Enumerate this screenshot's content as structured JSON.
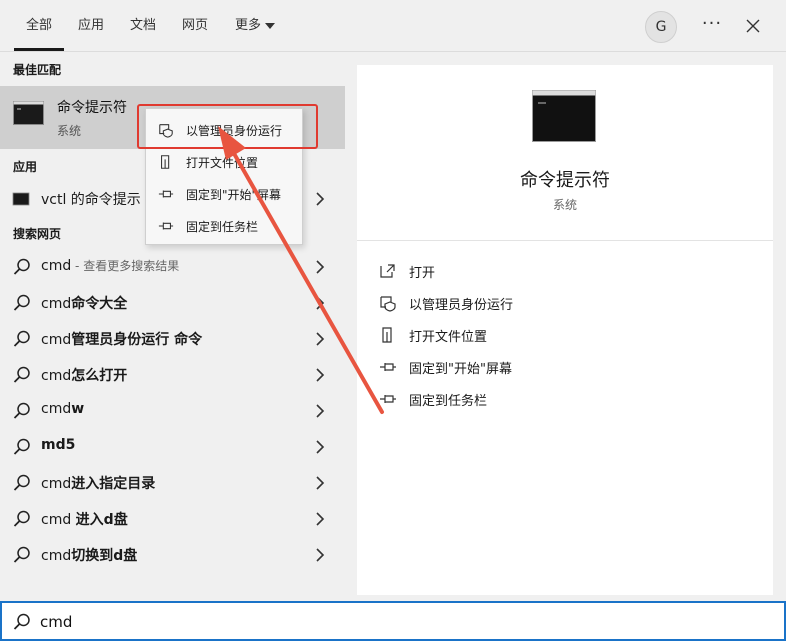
{
  "tabs": [
    {
      "label": "全部",
      "active": true
    },
    {
      "label": "应用"
    },
    {
      "label": "文档"
    },
    {
      "label": "网页"
    },
    {
      "label": "更多"
    }
  ],
  "account": {
    "initial": "G"
  },
  "sections": {
    "best_match": "最佳匹配",
    "apps": "应用",
    "web": "搜索网页"
  },
  "best_match": {
    "title": "命令提示符",
    "subtitle": "系统",
    "icon": "terminal-icon"
  },
  "apps": [
    {
      "label": "vctl 的命令提示"
    }
  ],
  "web_results": [
    {
      "prefix": "cmd",
      "bold": "",
      "dim": " - 查看更多搜索结果"
    },
    {
      "prefix": "cmd",
      "bold": "命令大全",
      "dim": ""
    },
    {
      "prefix": "cmd",
      "bold": "管理员身份运行 命令",
      "dim": ""
    },
    {
      "prefix": "cmd",
      "bold": "怎么打开",
      "dim": ""
    },
    {
      "prefix": "cmd",
      "bold": "w",
      "dim": ""
    },
    {
      "prefix": "",
      "bold": "md5",
      "dim": ""
    },
    {
      "prefix": "cmd",
      "bold": "进入指定目录",
      "dim": ""
    },
    {
      "prefix": "cmd ",
      "bold": "进入d盘",
      "dim": ""
    },
    {
      "prefix": "cmd",
      "bold": "切换到d盘",
      "dim": ""
    }
  ],
  "context_menu": [
    {
      "label": "以管理员身份运行",
      "icon": "shield-icon",
      "highlighted": true
    },
    {
      "label": "打开文件位置",
      "icon": "file-location-icon"
    },
    {
      "label": "固定到\"开始\"屏幕",
      "icon": "pin-icon"
    },
    {
      "label": "固定到任务栏",
      "icon": "pin-icon"
    }
  ],
  "detail": {
    "title": "命令提示符",
    "subtitle": "系统",
    "actions": [
      {
        "label": "打开",
        "icon": "open-icon"
      },
      {
        "label": "以管理员身份运行",
        "icon": "shield-icon"
      },
      {
        "label": "打开文件位置",
        "icon": "file-location-icon"
      },
      {
        "label": "固定到\"开始\"屏幕",
        "icon": "pin-icon"
      },
      {
        "label": "固定到任务栏",
        "icon": "pin-icon"
      }
    ]
  },
  "search": {
    "value": "cmd"
  },
  "colors": {
    "accent": "#1a73c8",
    "highlight": "#e03a30",
    "selected_row": "#cfcfcf"
  }
}
